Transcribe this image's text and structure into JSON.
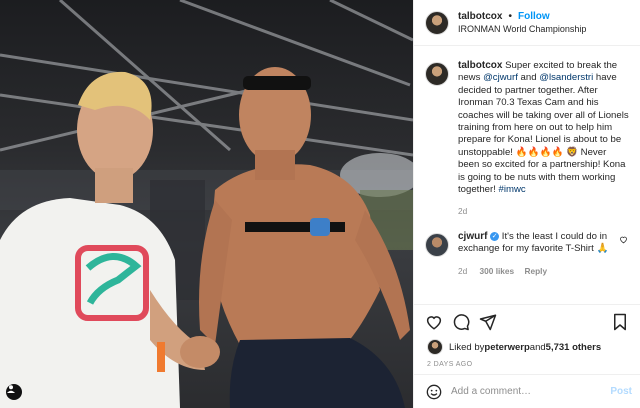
{
  "post": {
    "author": "talbotcox",
    "follow_label": "Follow",
    "separator": "•",
    "location": "IRONMAN World Championship"
  },
  "caption": {
    "username": "talbotcox",
    "text_1": "Super excited to break the news ",
    "mention_1": "@cjwurf",
    "text_2": " and ",
    "mention_2": "@lsanderstri",
    "text_3": " have decided to partner together. After Ironman 70.3 Texas Cam and his coaches will be taking over all of Lionels training from here on out to help him prepare for Kona! Lionel is about to be unstoppable! 🔥🔥🔥🔥 🦁 Never been so excited for a partnership! Kona is going to be nuts with them working together! ",
    "hashtag": "#imwc",
    "age": "2d"
  },
  "reply": {
    "username": "cjwurf",
    "text": "It's the least I could do in exchange for my favorite T-Shirt 🙏",
    "age": "2d",
    "likes": "300 likes",
    "reply_label": "Reply"
  },
  "likes": {
    "prefix": "Liked by ",
    "liked_by": "peterwerp",
    "middle": " and ",
    "others": "5,731 others"
  },
  "timestamp": "2 DAYS AGO",
  "comment_box": {
    "placeholder": "Add a comment…",
    "post_label": "Post"
  },
  "icons": [
    "heart-icon",
    "comment-icon",
    "share-icon",
    "bookmark-icon",
    "emoji-icon",
    "verified-icon",
    "user-tag-icon"
  ],
  "colors": {
    "link": "#00376b",
    "follow": "#0095f6",
    "verified": "#3897f0",
    "post_disabled": "#b3dbff"
  }
}
